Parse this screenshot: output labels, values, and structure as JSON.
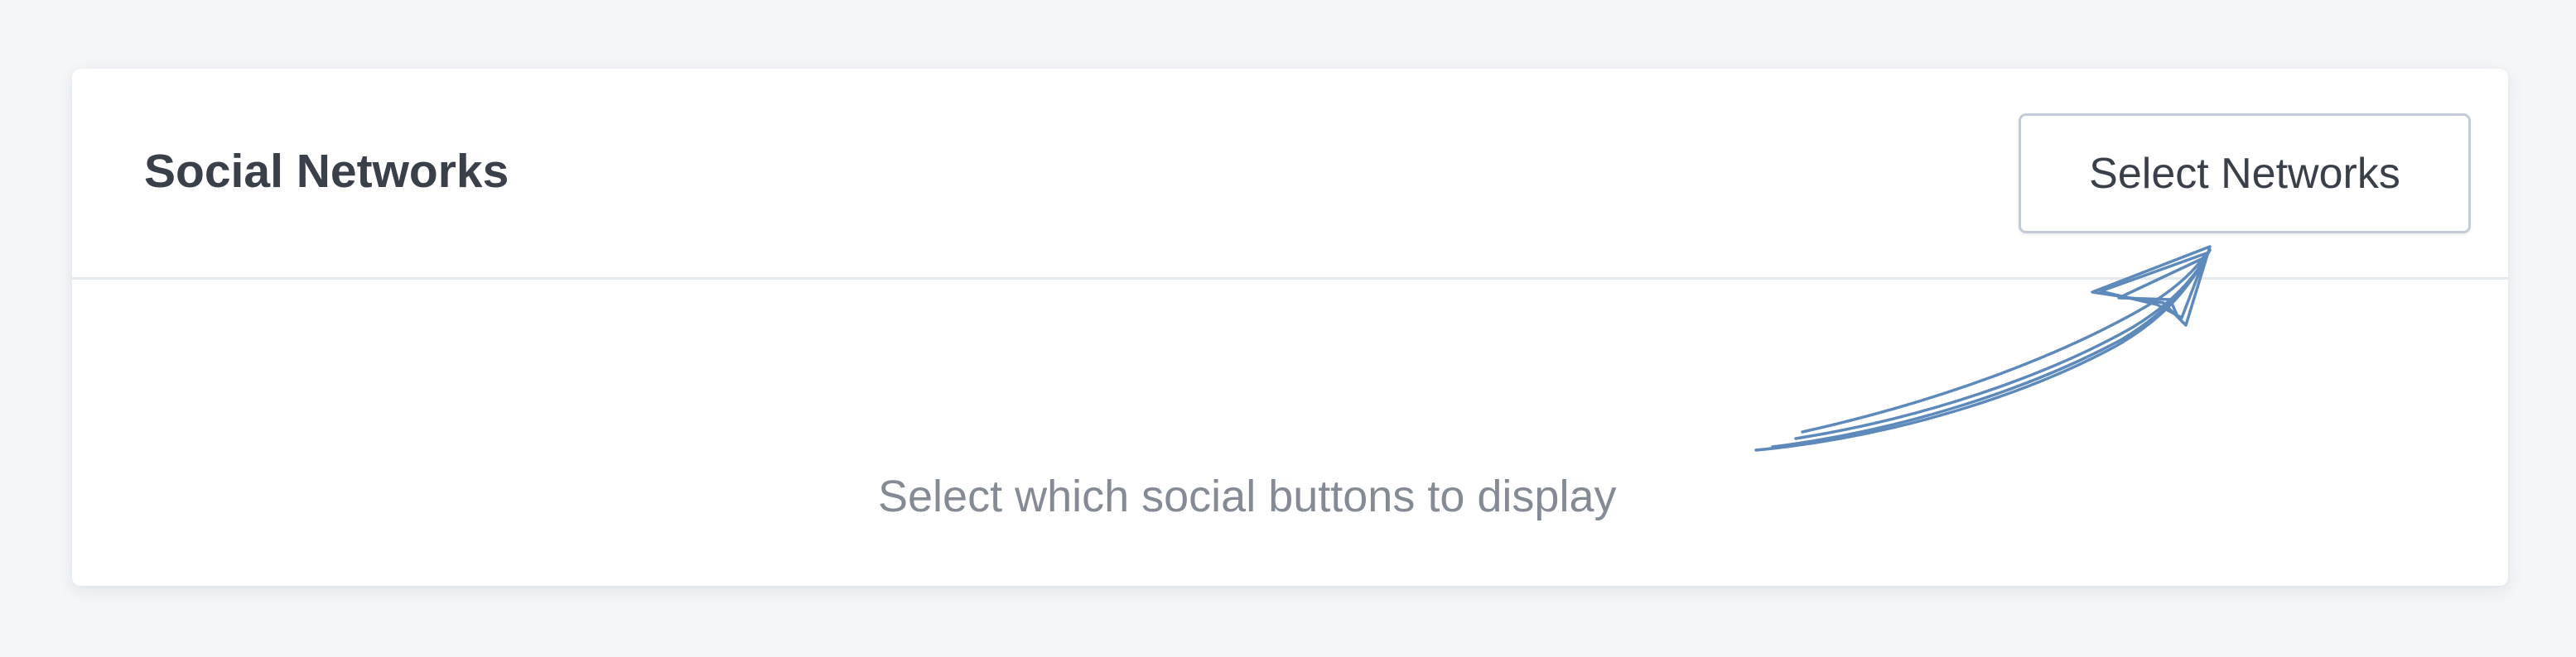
{
  "card": {
    "title": "Social Networks",
    "select_button_label": "Select Networks",
    "empty_hint": "Select which social buttons to display"
  },
  "icons": {
    "hint_arrow": "hand-drawn-arrow-icon"
  },
  "colors": {
    "page_background": "#f4f6f8",
    "card_background": "#ffffff",
    "title_text": "#3a4049",
    "hint_text": "#848b94",
    "arrow_stroke": "#5d89bb",
    "button_border": "#c2ccd6"
  }
}
